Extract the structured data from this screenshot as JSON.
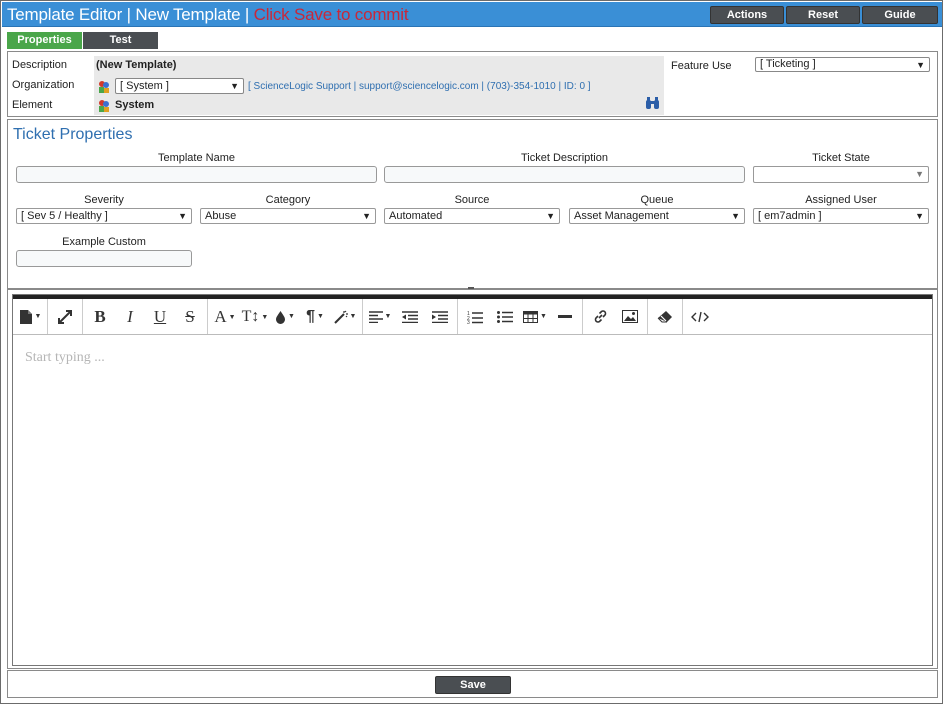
{
  "window": {
    "title": "Template Editor | New Template |",
    "commit_hint": "Click Save to commit",
    "buttons": {
      "actions": "Actions",
      "reset": "Reset",
      "guide": "Guide"
    }
  },
  "tabs": {
    "properties": "Properties",
    "test": "Test",
    "active": "Properties"
  },
  "header": {
    "description_label": "Description",
    "description_value": "(New Template)",
    "organization_label": "Organization",
    "organization_value": "[ System ]",
    "organization_info": "[ ScienceLogic Support | support@sciencelogic.com | (703)-354-1010 | ID: 0 ]",
    "element_label": "Element",
    "element_value": "System",
    "feature_use_label": "Feature Use",
    "feature_use_value": "[ Ticketing ]"
  },
  "ticket_properties": {
    "title": "Ticket Properties",
    "template_name": {
      "label": "Template Name",
      "value": ""
    },
    "ticket_description": {
      "label": "Ticket Description",
      "value": ""
    },
    "ticket_state": {
      "label": "Ticket State",
      "value": ""
    },
    "severity": {
      "label": "Severity",
      "value": "[ Sev 5 / Healthy ]"
    },
    "category": {
      "label": "Category",
      "value": "Abuse"
    },
    "source": {
      "label": "Source",
      "value": "Automated"
    },
    "queue": {
      "label": "Queue",
      "value": "Asset Management"
    },
    "assigned_user": {
      "label": "Assigned User",
      "value": "[ em7admin ]"
    },
    "example_custom": {
      "label": "Example Custom",
      "value": ""
    }
  },
  "editor": {
    "placeholder": "Start typing ...",
    "toolbar_icons": [
      "document-icon",
      "fullscreen-icon",
      "bold-icon",
      "italic-icon",
      "underline-icon",
      "strikethrough-icon",
      "font-color-icon",
      "font-size-icon",
      "fill-color-icon",
      "paragraph-icon",
      "magic-wand-icon",
      "align-icon",
      "outdent-icon",
      "indent-icon",
      "ordered-list-icon",
      "unordered-list-icon",
      "table-icon",
      "horizontal-rule-icon",
      "link-icon",
      "image-icon",
      "eraser-icon",
      "code-view-icon"
    ]
  },
  "footer": {
    "save_label": "Save"
  },
  "colors": {
    "titlebar": "#3a8fd6",
    "commit_hint": "#c8283a",
    "tab_active": "#4aa64a",
    "button_dark": "#4a4e52",
    "link_blue": "#2f6fb0"
  }
}
